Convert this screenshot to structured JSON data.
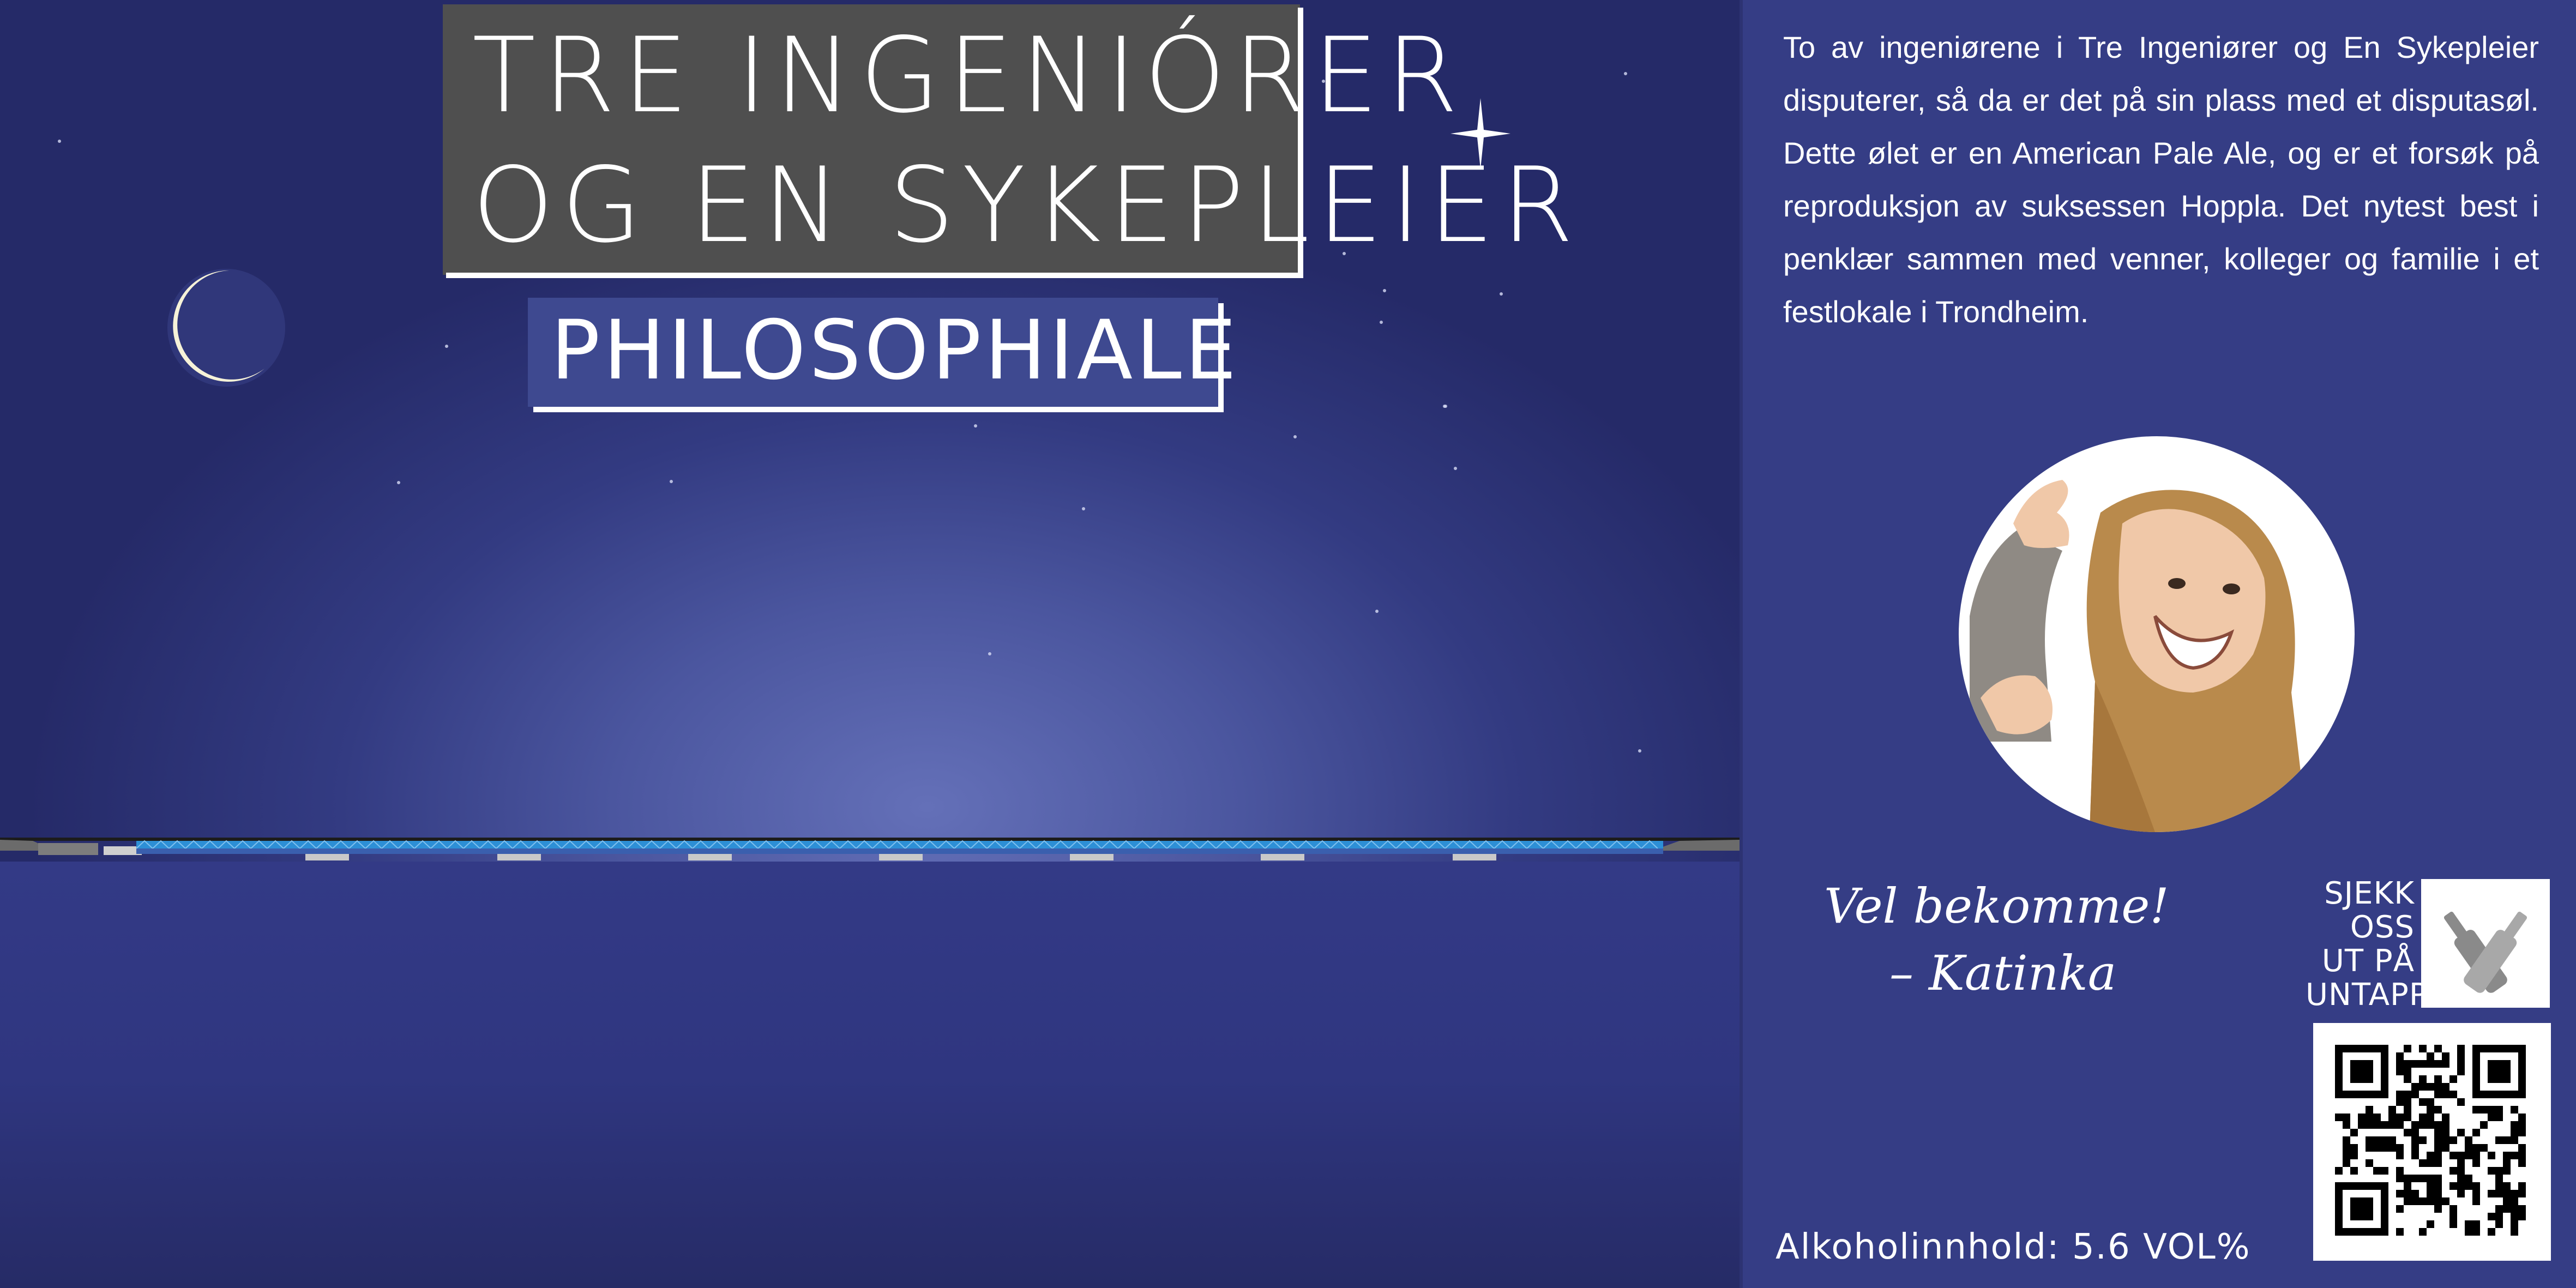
{
  "label": {
    "brewery_name_line1": "TRE INGENIÓRER",
    "brewery_name_line2": "OG EN SYKEPLEIER",
    "beer_name": "PHILOSOPHIALE"
  },
  "description": "To av ingeniørene i Tre Ingeniører og En Sykepleier disputerer, så da er det på sin plass med et disputasøl. Dette ølet er en American Pale Ale, og er et forsøk på reproduksjon av suksessen Hoppla. Det nytest best i penklær sammen med venner, kolleger og familie i et festlokale i Trondheim.",
  "signature": {
    "line1": "Vel bekomme!",
    "line2": "– Katinka"
  },
  "untappd": {
    "line1": "SJEKK",
    "line2": "OSS",
    "line3": "UT PÅ",
    "line4": "UNTAPPD"
  },
  "alcohol_content": "Alkoholinnhold: 5.6 VOL%",
  "icons": [
    "moon-icon",
    "sparkle-star-icon",
    "bridge-illustration",
    "portrait-photo",
    "untappd-bottles-icon",
    "qr-code"
  ],
  "colors": {
    "sky_dark": "#252a68",
    "sky_glow": "#6470b8",
    "panel": "#353d85",
    "title_box": "#4f4f4f",
    "bridge": "#2d8fd6"
  }
}
